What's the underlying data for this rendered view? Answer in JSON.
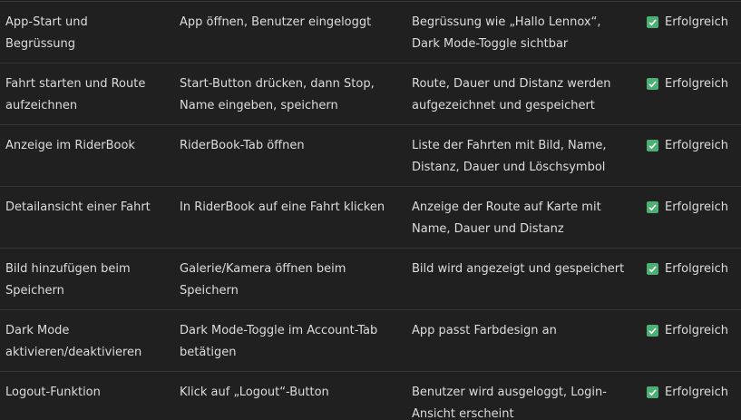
{
  "table": {
    "rows": [
      {
        "feature": "App-Start und Begrüssung",
        "action": "App öffnen, Benutzer eingeloggt",
        "expected": "Begrüssung wie „Hallo Lennox“, Dark Mode-Toggle sichtbar",
        "status": "Erfolgreich"
      },
      {
        "feature": "Fahrt starten und Route aufzeichnen",
        "action": "Start-Button drücken, dann Stop, Name eingeben, speichern",
        "expected": "Route, Dauer und Distanz werden aufgezeichnet und gespeichert",
        "status": "Erfolgreich"
      },
      {
        "feature": "Anzeige im RiderBook",
        "action": "RiderBook-Tab öffnen",
        "expected": "Liste der Fahrten mit Bild, Name, Distanz, Dauer und Löschsymbol",
        "status": "Erfolgreich"
      },
      {
        "feature": "Detailansicht einer Fahrt",
        "action": "In RiderBook auf eine Fahrt klicken",
        "expected": "Anzeige der Route auf Karte mit Name, Dauer und Distanz",
        "status": "Erfolgreich"
      },
      {
        "feature": "Bild hinzufügen beim Speichern",
        "action": "Galerie/Kamera öffnen beim Speichern",
        "expected": "Bild wird angezeigt und gespeichert",
        "status": "Erfolgreich"
      },
      {
        "feature": "Dark Mode aktivieren/deaktivieren",
        "action": "Dark Mode-Toggle im Account-Tab betätigen",
        "expected": "App passt Farbdesign an",
        "status": "Erfolgreich"
      },
      {
        "feature": "Logout-Funktion",
        "action": "Klick auf „Logout“-Button",
        "expected": "Benutzer wird ausgeloggt, Login-Ansicht erscheint",
        "status": "Erfolgreich"
      }
    ],
    "status_icon": "check-box-icon",
    "status_color": "#4caf73"
  }
}
